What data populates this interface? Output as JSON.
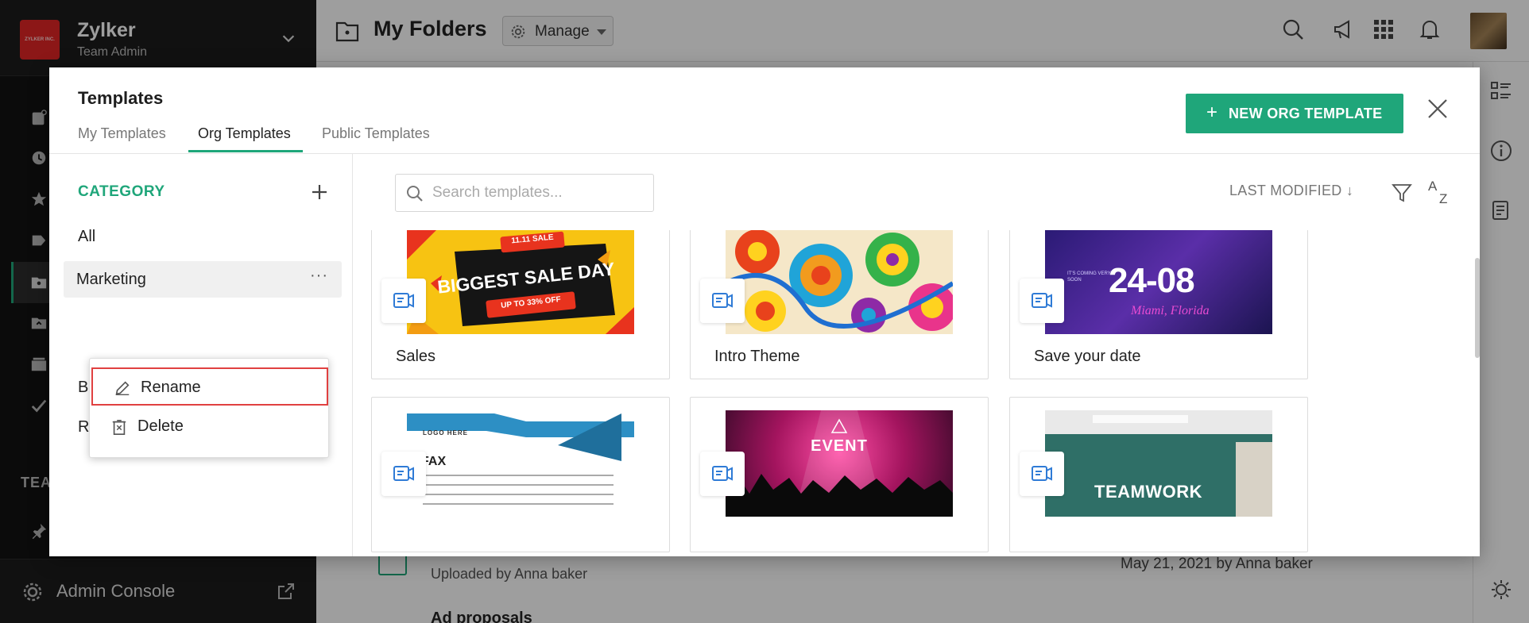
{
  "sidebar": {
    "org_name": "Zylker",
    "role": "Team Admin",
    "logo_text": "ZYLKER INC.",
    "section_label": "TEA",
    "footer_label": "Admin Console"
  },
  "header": {
    "title": "My Folders",
    "manage_label": "Manage"
  },
  "background_rows": {
    "row1_subtitle": "Uploaded by Anna baker",
    "row1_date": "May 21, 2021 by Anna baker",
    "row2_title": "Ad proposals"
  },
  "modal": {
    "title": "Templates",
    "tabs": [
      {
        "label": "My Templates",
        "active": false
      },
      {
        "label": "Org Templates",
        "active": true
      },
      {
        "label": "Public Templates",
        "active": false
      }
    ],
    "new_button_label": "NEW ORG TEMPLATE",
    "accent_color": "#1fa67a",
    "category_title": "CATEGORY",
    "categories": [
      "All",
      "Marketing",
      "Bu",
      "Re"
    ],
    "context_menu": [
      {
        "label": "Rename",
        "icon": "pencil-icon",
        "highlighted": true
      },
      {
        "label": "Delete",
        "icon": "trash-icon",
        "highlighted": false
      }
    ],
    "search_placeholder": "Search templates...",
    "sort_label": "LAST MODIFIED ↓",
    "templates": [
      {
        "name": "Sales",
        "thumb_text": "BIGGEST SALE DAY",
        "thumb_top": "11.11 SALE",
        "thumb_bottom": "UP TO 33% OFF"
      },
      {
        "name": "Intro Theme"
      },
      {
        "name": "Save your date",
        "thumb_text": "24-08",
        "thumb_sub": "Miami, Florida",
        "thumb_top": "IT'S COMING VERY SOON"
      },
      {
        "name": "",
        "thumb_text": "FAX",
        "thumb_top": "LOGO HERE"
      },
      {
        "name": "",
        "thumb_text": "EVENT"
      },
      {
        "name": "",
        "thumb_text": "TEAMWORK"
      }
    ]
  }
}
